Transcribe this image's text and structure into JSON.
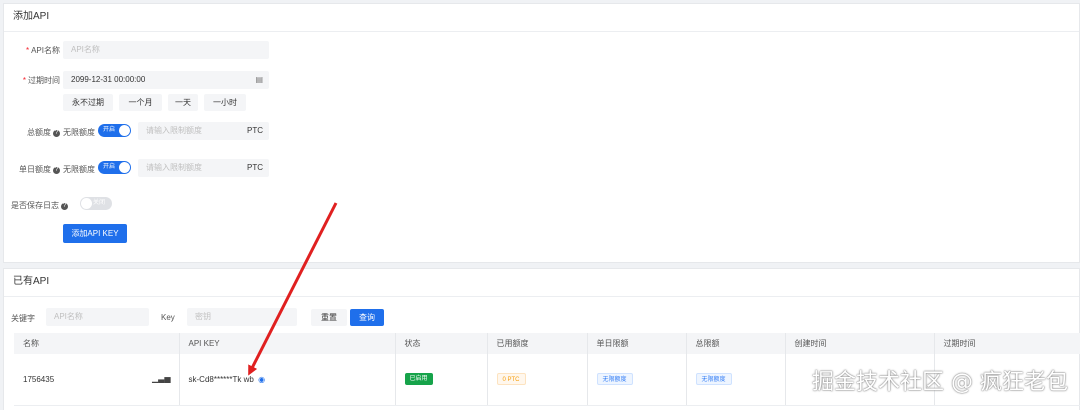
{
  "add_card": {
    "title": "添加API",
    "name_label": "API名称",
    "name_placeholder": "API名称",
    "expire_label": "过期时间",
    "expire_value": "2099-12-31 00:00:00",
    "quick_buttons": [
      "永不过期",
      "一个月",
      "一天",
      "一小时"
    ],
    "total_label": "总额度",
    "unlimited_label": "无限额度",
    "toggle_on": "开启",
    "limit_placeholder": "请输入限制额度",
    "unit": "PTC",
    "daily_label": "单日额度",
    "save_log_label": "是否保存日志",
    "toggle_off": "关闭",
    "submit": "添加API KEY"
  },
  "list_card": {
    "title": "已有API",
    "keyword_label": "关键字",
    "keyword_placeholder": "API名称",
    "key_label": "Key",
    "key_placeholder": "密钥",
    "reset": "重置",
    "search": "查询",
    "columns": [
      "名称",
      "API KEY",
      "状态",
      "已用额度",
      "单日限额",
      "总限额",
      "创建时间",
      "过期时间"
    ],
    "rows": [
      {
        "name": "1756435",
        "api_key": "sk-Cd8******Tk  wb",
        "status": "已启用",
        "used": "0 PTC",
        "daily": "无限额度",
        "total": "无限额度",
        "created": "",
        "expire": ""
      }
    ]
  },
  "watermark": "掘金技术社区 @ 疯狂老包",
  "colors": {
    "primary": "#1f6feb",
    "danger": "#f5222d",
    "success": "#16a34a",
    "annotation_arrow": "#e02020"
  }
}
